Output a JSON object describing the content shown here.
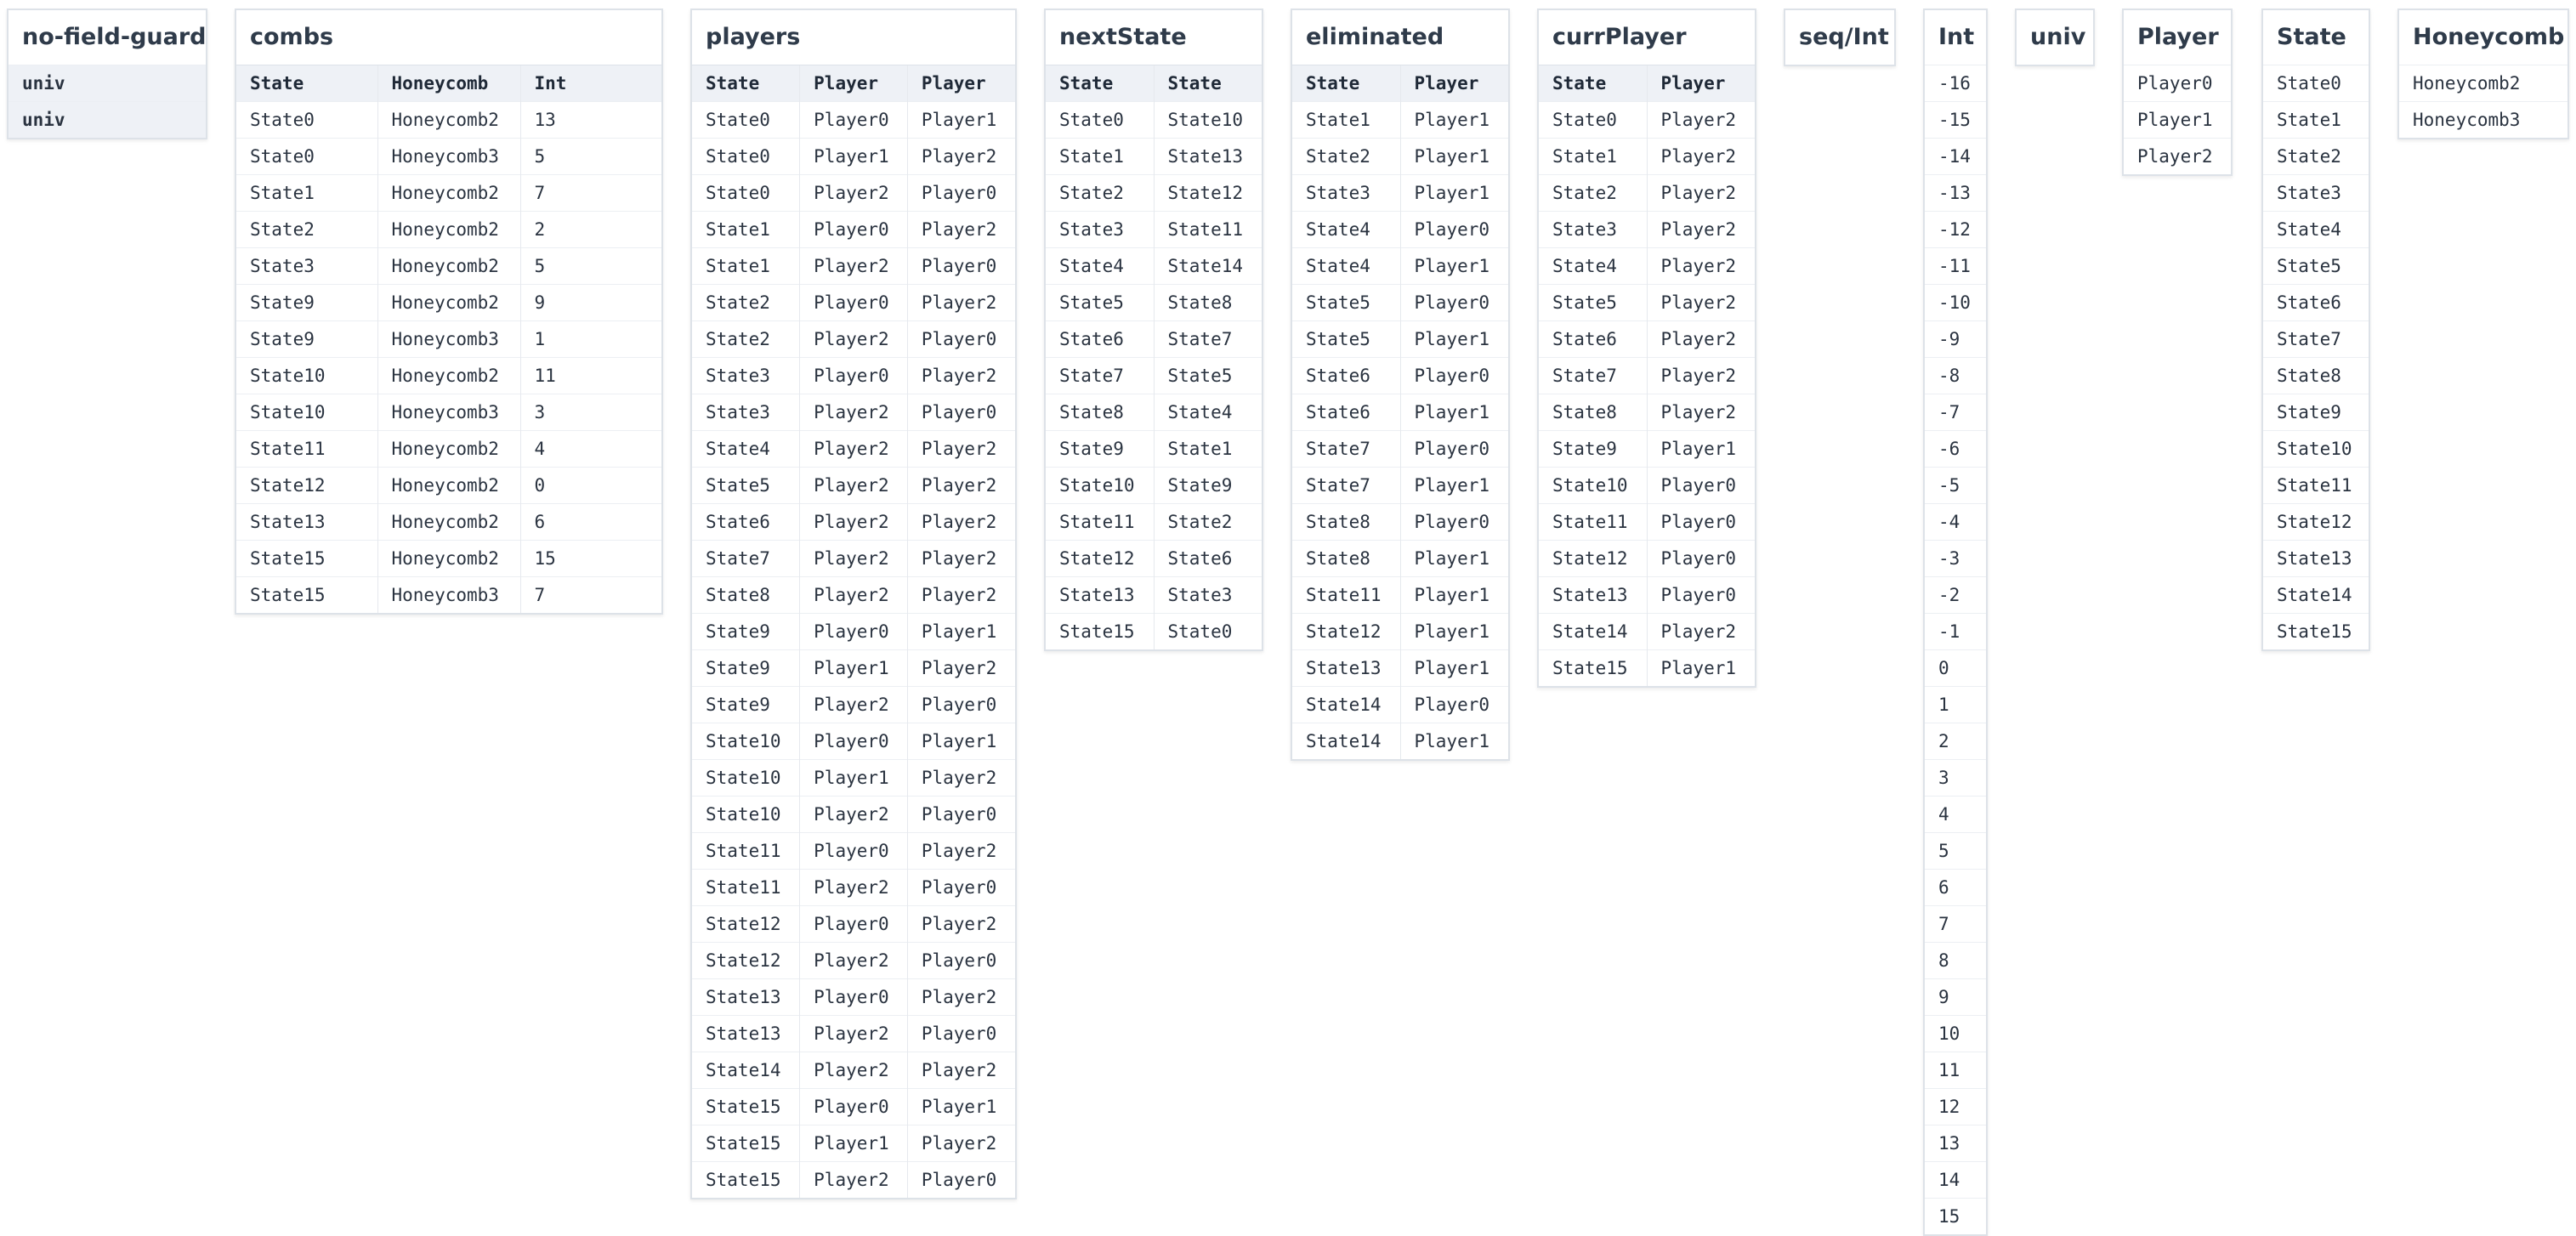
{
  "tables": {
    "no_field_guard": {
      "title": "no-field-guard",
      "rows": [
        [
          "univ"
        ],
        [
          "univ"
        ]
      ]
    },
    "combs": {
      "title": "combs",
      "columns": [
        "State",
        "Honeycomb",
        "Int"
      ],
      "rows": [
        [
          "State0",
          "Honeycomb2",
          "13"
        ],
        [
          "State0",
          "Honeycomb3",
          "5"
        ],
        [
          "State1",
          "Honeycomb2",
          "7"
        ],
        [
          "State2",
          "Honeycomb2",
          "2"
        ],
        [
          "State3",
          "Honeycomb2",
          "5"
        ],
        [
          "State9",
          "Honeycomb2",
          "9"
        ],
        [
          "State9",
          "Honeycomb3",
          "1"
        ],
        [
          "State10",
          "Honeycomb2",
          "11"
        ],
        [
          "State10",
          "Honeycomb3",
          "3"
        ],
        [
          "State11",
          "Honeycomb2",
          "4"
        ],
        [
          "State12",
          "Honeycomb2",
          "0"
        ],
        [
          "State13",
          "Honeycomb2",
          "6"
        ],
        [
          "State15",
          "Honeycomb2",
          "15"
        ],
        [
          "State15",
          "Honeycomb3",
          "7"
        ]
      ]
    },
    "players": {
      "title": "players",
      "columns": [
        "State",
        "Player",
        "Player"
      ],
      "rows": [
        [
          "State0",
          "Player0",
          "Player1"
        ],
        [
          "State0",
          "Player1",
          "Player2"
        ],
        [
          "State0",
          "Player2",
          "Player0"
        ],
        [
          "State1",
          "Player0",
          "Player2"
        ],
        [
          "State1",
          "Player2",
          "Player0"
        ],
        [
          "State2",
          "Player0",
          "Player2"
        ],
        [
          "State2",
          "Player2",
          "Player0"
        ],
        [
          "State3",
          "Player0",
          "Player2"
        ],
        [
          "State3",
          "Player2",
          "Player0"
        ],
        [
          "State4",
          "Player2",
          "Player2"
        ],
        [
          "State5",
          "Player2",
          "Player2"
        ],
        [
          "State6",
          "Player2",
          "Player2"
        ],
        [
          "State7",
          "Player2",
          "Player2"
        ],
        [
          "State8",
          "Player2",
          "Player2"
        ],
        [
          "State9",
          "Player0",
          "Player1"
        ],
        [
          "State9",
          "Player1",
          "Player2"
        ],
        [
          "State9",
          "Player2",
          "Player0"
        ],
        [
          "State10",
          "Player0",
          "Player1"
        ],
        [
          "State10",
          "Player1",
          "Player2"
        ],
        [
          "State10",
          "Player2",
          "Player0"
        ],
        [
          "State11",
          "Player0",
          "Player2"
        ],
        [
          "State11",
          "Player2",
          "Player0"
        ],
        [
          "State12",
          "Player0",
          "Player2"
        ],
        [
          "State12",
          "Player2",
          "Player0"
        ],
        [
          "State13",
          "Player0",
          "Player2"
        ],
        [
          "State13",
          "Player2",
          "Player0"
        ],
        [
          "State14",
          "Player2",
          "Player2"
        ],
        [
          "State15",
          "Player0",
          "Player1"
        ],
        [
          "State15",
          "Player1",
          "Player2"
        ],
        [
          "State15",
          "Player2",
          "Player0"
        ]
      ]
    },
    "nextState": {
      "title": "nextState",
      "columns": [
        "State",
        "State"
      ],
      "rows": [
        [
          "State0",
          "State10"
        ],
        [
          "State1",
          "State13"
        ],
        [
          "State2",
          "State12"
        ],
        [
          "State3",
          "State11"
        ],
        [
          "State4",
          "State14"
        ],
        [
          "State5",
          "State8"
        ],
        [
          "State6",
          "State7"
        ],
        [
          "State7",
          "State5"
        ],
        [
          "State8",
          "State4"
        ],
        [
          "State9",
          "State1"
        ],
        [
          "State10",
          "State9"
        ],
        [
          "State11",
          "State2"
        ],
        [
          "State12",
          "State6"
        ],
        [
          "State13",
          "State3"
        ],
        [
          "State15",
          "State0"
        ]
      ]
    },
    "eliminated": {
      "title": "eliminated",
      "columns": [
        "State",
        "Player"
      ],
      "rows": [
        [
          "State1",
          "Player1"
        ],
        [
          "State2",
          "Player1"
        ],
        [
          "State3",
          "Player1"
        ],
        [
          "State4",
          "Player0"
        ],
        [
          "State4",
          "Player1"
        ],
        [
          "State5",
          "Player0"
        ],
        [
          "State5",
          "Player1"
        ],
        [
          "State6",
          "Player0"
        ],
        [
          "State6",
          "Player1"
        ],
        [
          "State7",
          "Player0"
        ],
        [
          "State7",
          "Player1"
        ],
        [
          "State8",
          "Player0"
        ],
        [
          "State8",
          "Player1"
        ],
        [
          "State11",
          "Player1"
        ],
        [
          "State12",
          "Player1"
        ],
        [
          "State13",
          "Player1"
        ],
        [
          "State14",
          "Player0"
        ],
        [
          "State14",
          "Player1"
        ]
      ]
    },
    "currPlayer": {
      "title": "currPlayer",
      "columns": [
        "State",
        "Player"
      ],
      "rows": [
        [
          "State0",
          "Player2"
        ],
        [
          "State1",
          "Player2"
        ],
        [
          "State2",
          "Player2"
        ],
        [
          "State3",
          "Player2"
        ],
        [
          "State4",
          "Player2"
        ],
        [
          "State5",
          "Player2"
        ],
        [
          "State6",
          "Player2"
        ],
        [
          "State7",
          "Player2"
        ],
        [
          "State8",
          "Player2"
        ],
        [
          "State9",
          "Player1"
        ],
        [
          "State10",
          "Player0"
        ],
        [
          "State11",
          "Player0"
        ],
        [
          "State12",
          "Player0"
        ],
        [
          "State13",
          "Player0"
        ],
        [
          "State14",
          "Player2"
        ],
        [
          "State15",
          "Player1"
        ]
      ]
    },
    "seqInt": {
      "title": "seq/Int",
      "rows": []
    },
    "Int": {
      "title": "Int",
      "rows": [
        [
          "-16"
        ],
        [
          "-15"
        ],
        [
          "-14"
        ],
        [
          "-13"
        ],
        [
          "-12"
        ],
        [
          "-11"
        ],
        [
          "-10"
        ],
        [
          "-9"
        ],
        [
          "-8"
        ],
        [
          "-7"
        ],
        [
          "-6"
        ],
        [
          "-5"
        ],
        [
          "-4"
        ],
        [
          "-3"
        ],
        [
          "-2"
        ],
        [
          "-1"
        ],
        [
          "0"
        ],
        [
          "1"
        ],
        [
          "2"
        ],
        [
          "3"
        ],
        [
          "4"
        ],
        [
          "5"
        ],
        [
          "6"
        ],
        [
          "7"
        ],
        [
          "8"
        ],
        [
          "9"
        ],
        [
          "10"
        ],
        [
          "11"
        ],
        [
          "12"
        ],
        [
          "13"
        ],
        [
          "14"
        ],
        [
          "15"
        ]
      ]
    },
    "univ": {
      "title": "univ",
      "rows": []
    },
    "Player": {
      "title": "Player",
      "rows": [
        [
          "Player0"
        ],
        [
          "Player1"
        ],
        [
          "Player2"
        ]
      ]
    },
    "State": {
      "title": "State",
      "rows": [
        [
          "State0"
        ],
        [
          "State1"
        ],
        [
          "State2"
        ],
        [
          "State3"
        ],
        [
          "State4"
        ],
        [
          "State5"
        ],
        [
          "State6"
        ],
        [
          "State7"
        ],
        [
          "State8"
        ],
        [
          "State9"
        ],
        [
          "State10"
        ],
        [
          "State11"
        ],
        [
          "State12"
        ],
        [
          "State13"
        ],
        [
          "State14"
        ],
        [
          "State15"
        ]
      ]
    },
    "Honeycomb": {
      "title": "Honeycomb",
      "rows": [
        [
          "Honeycomb2"
        ],
        [
          "Honeycomb3"
        ]
      ]
    }
  }
}
